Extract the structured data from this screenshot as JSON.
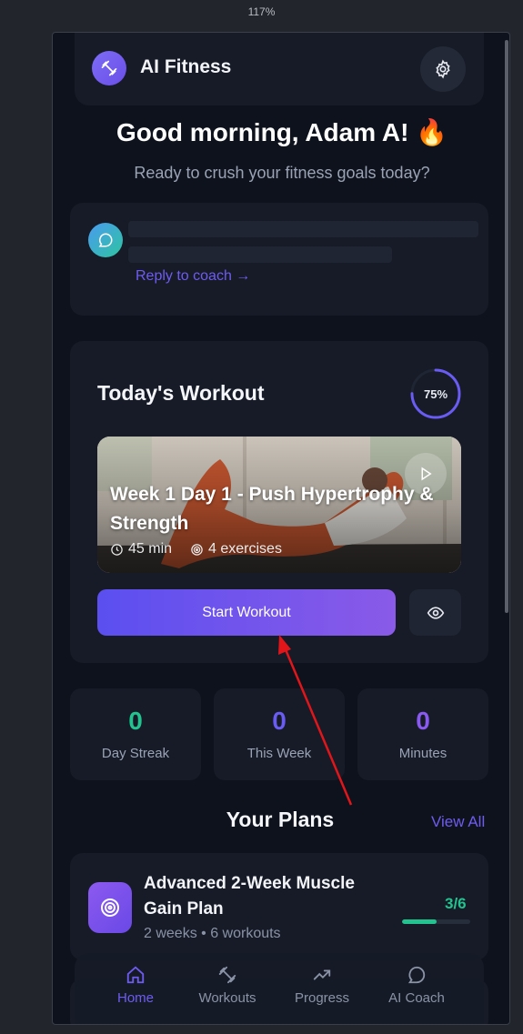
{
  "zoom": "117%",
  "app": {
    "title": "AI Fitness"
  },
  "greeting": {
    "title": "Good morning, Adam A! 🔥",
    "subtitle": "Ready to crush your fitness goals today?"
  },
  "coach_message": {
    "reply_label": "Reply to coach →"
  },
  "todays_workout": {
    "heading": "Today's Workout",
    "progress_label": "75%",
    "progress_fraction": 0.75,
    "name": "Week 1 Day 1 - Push Hypertrophy & Strength",
    "duration": "45 min",
    "exercises": "4 exercises",
    "start_label": "Start Workout"
  },
  "stats": [
    {
      "value": "0",
      "label": "Day Streak",
      "color": "#22c38e"
    },
    {
      "value": "0",
      "label": "This Week",
      "color": "#6a5cf2"
    },
    {
      "value": "0",
      "label": "Minutes",
      "color": "#8a5af0"
    }
  ],
  "plans": {
    "heading": "Your Plans",
    "view_all": "View All",
    "items": [
      {
        "name": "Advanced 2-Week Muscle Gain Plan",
        "meta": "2 weeks • 6 workouts",
        "count": "3/6",
        "progress_fraction": 0.5
      }
    ]
  },
  "nav": {
    "items": [
      {
        "label": "Home",
        "icon": "home-icon",
        "active": true
      },
      {
        "label": "Workouts",
        "icon": "dumbbell-icon",
        "active": false
      },
      {
        "label": "Progress",
        "icon": "trend-up-icon",
        "active": false
      },
      {
        "label": "AI Coach",
        "icon": "chat-bubble-icon",
        "active": false
      }
    ]
  },
  "colors": {
    "accent": "#6e5cf0",
    "success": "#22c38e",
    "background": "#0e121c",
    "card": "#161b27",
    "annotation": "#e0161b"
  }
}
